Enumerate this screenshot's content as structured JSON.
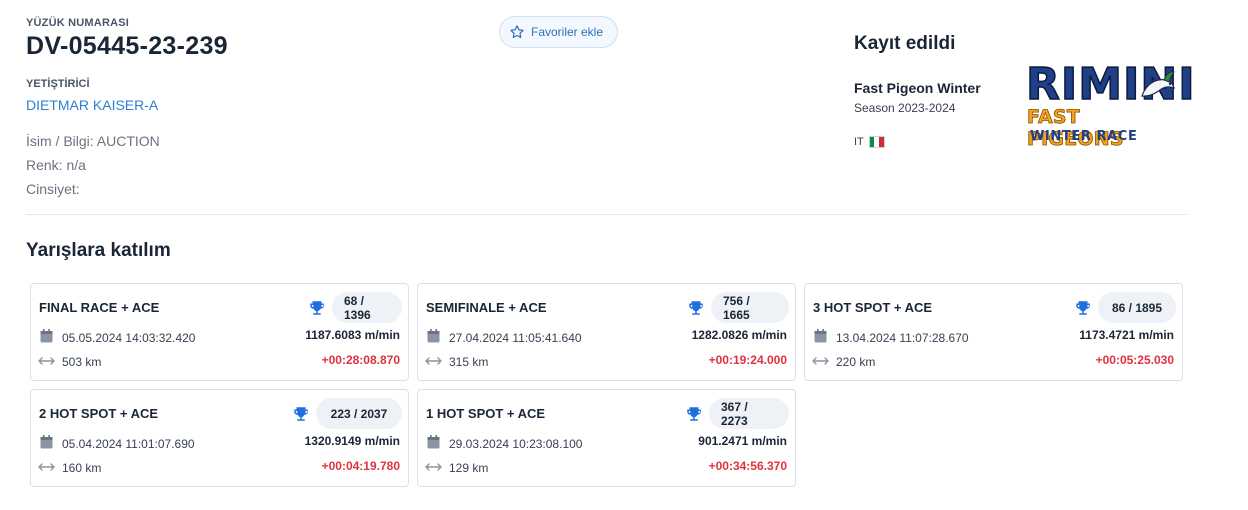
{
  "pigeon": {
    "ring_label": "YÜZÜK NUMARASI",
    "ring_number": "DV-05445-23-239",
    "breeder_label": "YETİŞTİRİCİ",
    "breeder_name": "DIETMAR KAISER-A",
    "name_info": "İsim / Bilgi: AUCTION",
    "color": "Renk: n/a",
    "gender": "Cinsiyet:"
  },
  "favorite_button": {
    "label": "Favoriler ekle",
    "icon": "star-outline-icon"
  },
  "registration": {
    "title": "Kayıt edildi",
    "race_name": "Fast Pigeon Winter",
    "season": "Season 2023-2024",
    "country_code": "IT",
    "flag_colors": [
      "#009246",
      "#ffffff",
      "#ce2b37"
    ],
    "logo_line1": "RIMINI",
    "logo_line2": "FAST PIGEONS",
    "logo_line3": "WINTER RACE"
  },
  "section": {
    "title": "Yarışlara katılım"
  },
  "colors": {
    "accent": "#2f7fd1",
    "trophy": "#1f6fe0",
    "negative": "#e0323e",
    "pill_bg": "#eef2f7"
  },
  "races": [
    {
      "name": "FINAL RACE + ACE",
      "rank": "68 / 1396",
      "date": "05.05.2024 14:03:32.420",
      "speed": "1187.6083 m/min",
      "distance": "503 km",
      "diff": "+00:28:08.870"
    },
    {
      "name": "SEMIFINALE + ACE",
      "rank": "756 / 1665",
      "date": "27.04.2024 11:05:41.640",
      "speed": "1282.0826 m/min",
      "distance": "315 km",
      "diff": "+00:19:24.000"
    },
    {
      "name": "3 HOT SPOT + ACE",
      "rank": "86 / 1895",
      "date": "13.04.2024 11:07:28.670",
      "speed": "1173.4721 m/min",
      "distance": "220 km",
      "diff": "+00:05:25.030"
    },
    {
      "name": "2 HOT SPOT + ACE",
      "rank": "223 / 2037",
      "date": "05.04.2024 11:01:07.690",
      "speed": "1320.9149 m/min",
      "distance": "160 km",
      "diff": "+00:04:19.780"
    },
    {
      "name": "1 HOT SPOT + ACE",
      "rank": "367 / 2273",
      "date": "29.03.2024 10:23:08.100",
      "speed": "901.2471 m/min",
      "distance": "129 km",
      "diff": "+00:34:56.370"
    }
  ]
}
